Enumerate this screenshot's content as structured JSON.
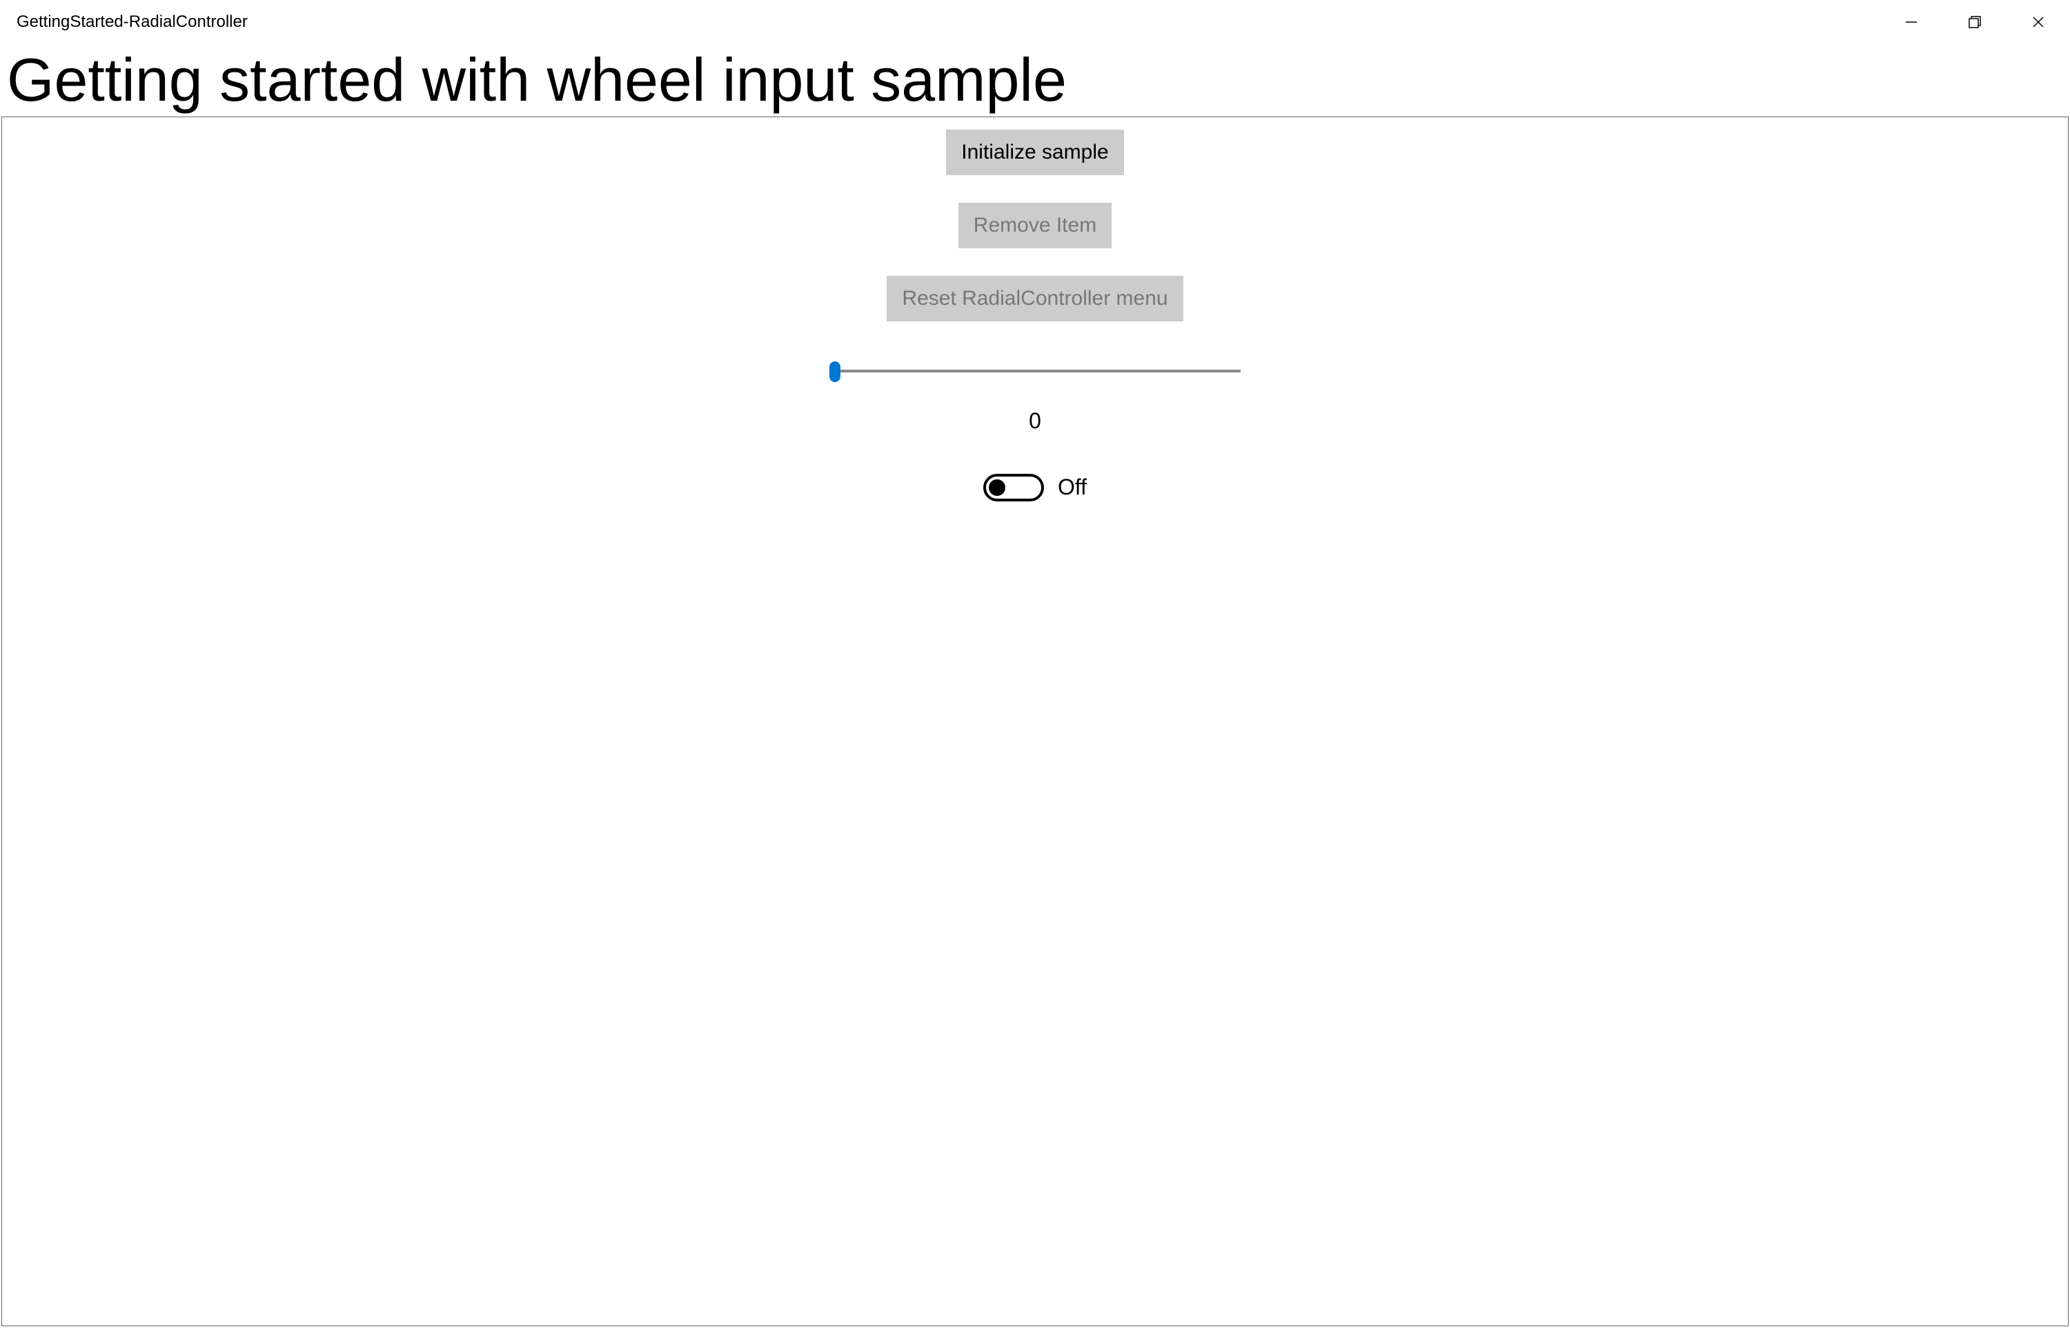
{
  "window": {
    "title": "GettingStarted-RadialController"
  },
  "page": {
    "heading": "Getting started with wheel input sample"
  },
  "controls": {
    "buttons": {
      "initialize": "Initialize sample",
      "remove": "Remove Item",
      "reset": "Reset RadialController menu"
    },
    "slider": {
      "value": "0"
    },
    "toggle": {
      "state": "Off"
    }
  }
}
